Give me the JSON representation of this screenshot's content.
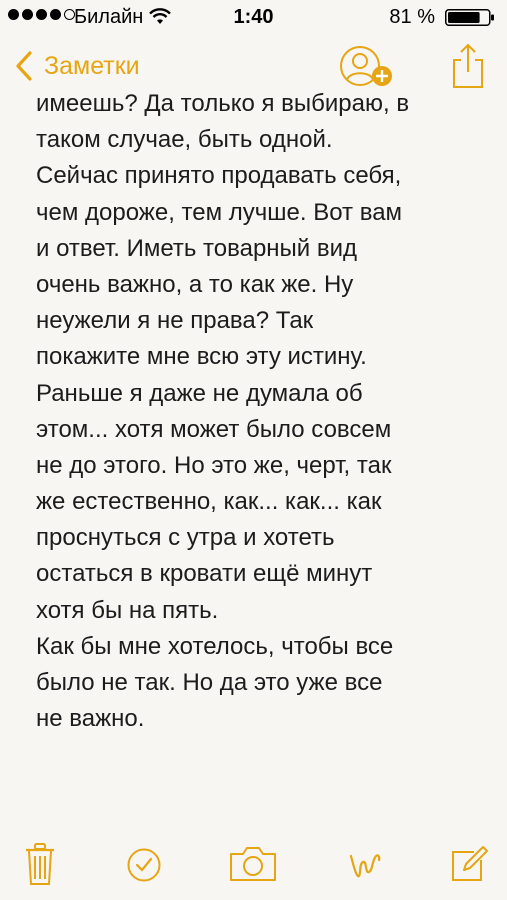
{
  "status_bar": {
    "carrier": "Билайн",
    "time": "1:40",
    "battery_percent": "81 %",
    "signal_bars_filled": 4,
    "signal_bars_total": 5,
    "battery_level": 0.81
  },
  "nav": {
    "back_label": "Заметки",
    "accent_color": "#e6a514"
  },
  "note": {
    "lines": [
      "имеешь? Да только я выбираю, в",
      "таком случае, быть одной.",
      "Сейчас принято продавать себя,",
      "чем дороже, тем лучше. Вот вам",
      "и ответ. Иметь товарный вид",
      "очень важно, а то как же. Ну",
      "неужели я не права? Так",
      "покажите мне всю эту истину.",
      "Раньше я даже не думала об",
      "этом... хотя может было совсем",
      "не до этого. Но это же, черт, так",
      "же естественно, как... как... как",
      "проснуться с утра и хотеть",
      "остаться в кровати ещё минут",
      "хотя бы на пять.",
      "Как бы мне хотелось, чтобы все",
      "было не так. Но да это уже все",
      "не важно."
    ]
  },
  "toolbar": {
    "icons": [
      "trash-icon",
      "checklist-icon",
      "camera-icon",
      "sketch-icon",
      "compose-icon"
    ]
  }
}
